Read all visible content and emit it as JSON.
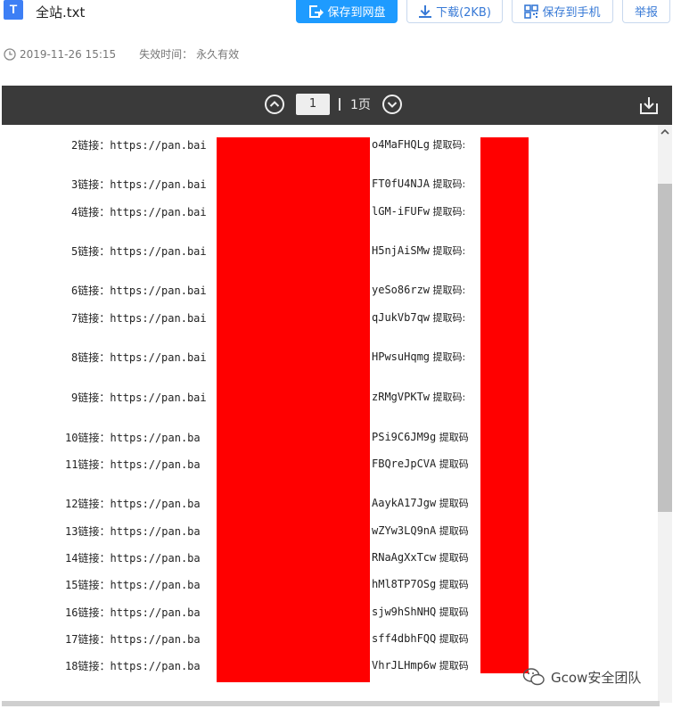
{
  "header": {
    "file_icon_letter": "T",
    "file_name": "全站.txt",
    "buttons": {
      "save_netdisk": "保存到网盘",
      "download": "下载(2KB)",
      "save_phone": "保存到手机",
      "report": "举报"
    }
  },
  "meta": {
    "date": "2019-11-26 15:15",
    "expiry_label": "失效时间：",
    "expiry_value": "永久有效"
  },
  "viewer": {
    "page_value": "1",
    "page_total": "1页"
  },
  "doc": {
    "lines": [
      {
        "num": "2",
        "label": "链接：",
        "url": "https://pan.bai",
        "code": "o4MaFHQLg",
        "code_label": "提取码:"
      },
      {
        "num": "3",
        "label": "链接：",
        "url": "https://pan.bai",
        "code": "FT0fU4NJA",
        "code_label": "提取码:"
      },
      {
        "num": "4",
        "label": "链接：",
        "url": "https://pan.bai",
        "code": "lGM-iFUFw",
        "code_label": "提取码:"
      },
      {
        "num": "5",
        "label": "链接：",
        "url": "https://pan.bai",
        "code": "H5njAiSMw",
        "code_label": "提取码:"
      },
      {
        "num": "6",
        "label": "链接：",
        "url": "https://pan.bai",
        "code": "yeSo86rzw",
        "code_label": "提取码:"
      },
      {
        "num": "7",
        "label": "链接：",
        "url": "https://pan.bai",
        "code": "qJukVb7qw",
        "code_label": "提取码:"
      },
      {
        "num": "8",
        "label": "链接：",
        "url": "https://pan.bai",
        "code": "HPwsuHqmg",
        "code_label": "提取码:"
      },
      {
        "num": "9",
        "label": "链接：",
        "url": "https://pan.bai",
        "code": "zRMgVPKTw",
        "code_label": "提取码:"
      },
      {
        "num": "10",
        "label": "链接：",
        "url": "https://pan.ba",
        "code": "PSi9C6JM9g",
        "code_label": "提取码"
      },
      {
        "num": "11",
        "label": "链接：",
        "url": "https://pan.ba",
        "code": "FBQreJpCVA",
        "code_label": "提取码"
      },
      {
        "num": "12",
        "label": "链接：",
        "url": "https://pan.ba",
        "code": "AaykA17Jgw",
        "code_label": "提取码"
      },
      {
        "num": "13",
        "label": "链接：",
        "url": "https://pan.ba",
        "code": "wZYw3LQ9nA",
        "code_label": "提取码"
      },
      {
        "num": "14",
        "label": "链接：",
        "url": "https://pan.ba",
        "code": "RNaAgXxTcw",
        "code_label": "提取码"
      },
      {
        "num": "15",
        "label": "链接：",
        "url": "https://pan.ba",
        "code": "hMl8TP7OSg",
        "code_label": "提取码"
      },
      {
        "num": "16",
        "label": "链接：",
        "url": "https://pan.ba",
        "code": "sjw9hShNHQ",
        "code_label": "提取码"
      },
      {
        "num": "17",
        "label": "链接：",
        "url": "https://pan.ba",
        "code": "sff4dbhFQQ",
        "code_label": "提取码"
      },
      {
        "num": "18",
        "label": "链接：",
        "url": "https://pan.ba",
        "code": "VhrJLHmp6w",
        "code_label": "提取码"
      }
    ]
  },
  "watermark": {
    "text": "Gcow安全团队"
  },
  "colors": {
    "primary_button": "#1e9bff",
    "toolbar_bg": "#3a3a3a",
    "redaction": "#ff0000",
    "link_text": "#3779d6"
  }
}
